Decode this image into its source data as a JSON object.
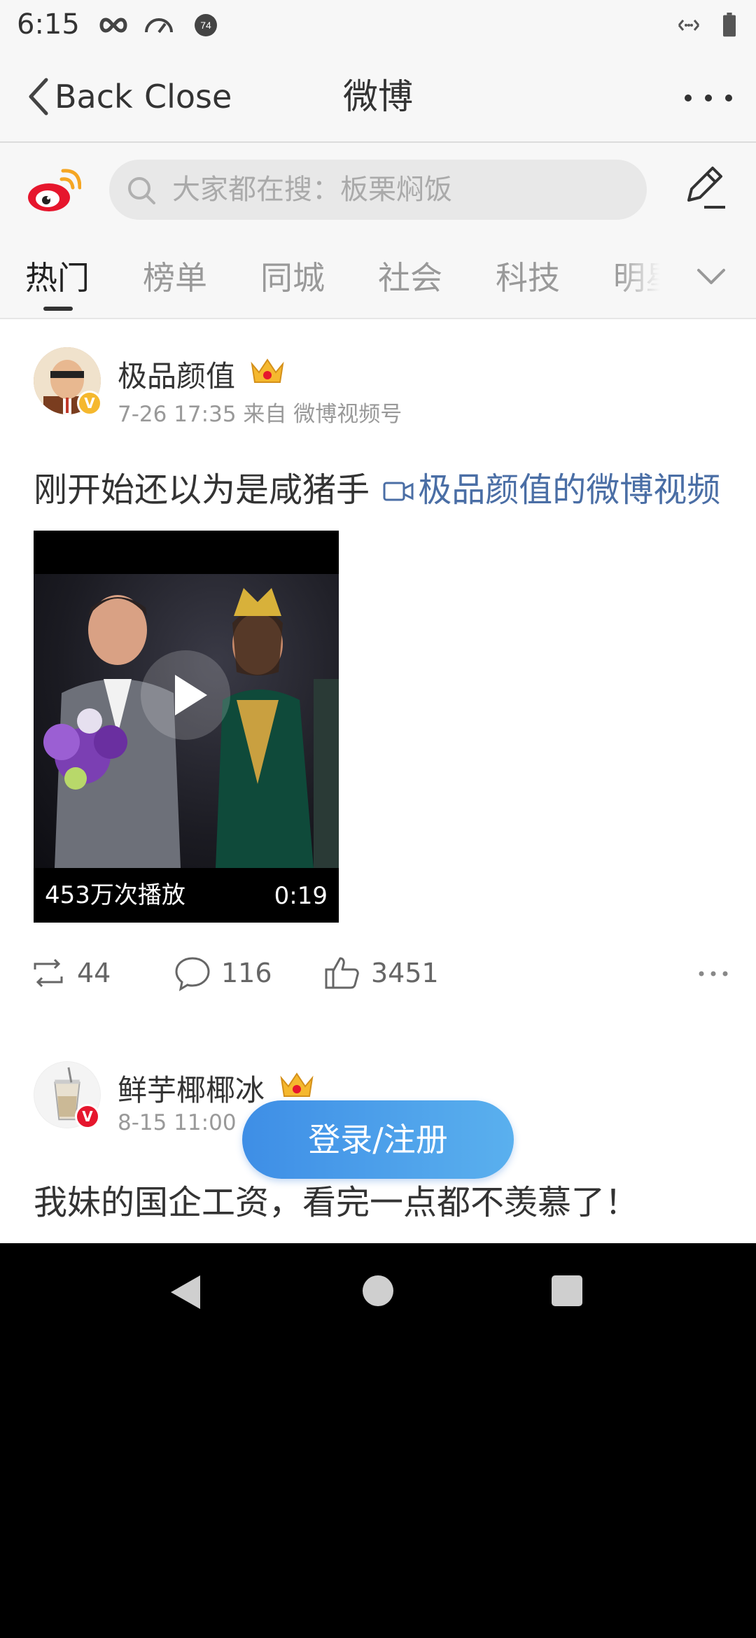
{
  "status_bar": {
    "time": "6:15",
    "icons": [
      "infinity-icon",
      "speedometer-icon",
      "notification-74-icon",
      "data-arrows-icon",
      "battery-icon"
    ],
    "notification_badge": "74"
  },
  "nav": {
    "back_label": "Back",
    "close_label": "Close",
    "title": "微博"
  },
  "search": {
    "placeholder": "大家都在搜：板栗焖饭"
  },
  "tabs": [
    {
      "label": "热门",
      "active": true
    },
    {
      "label": "榜单",
      "active": false
    },
    {
      "label": "同城",
      "active": false
    },
    {
      "label": "社会",
      "active": false
    },
    {
      "label": "科技",
      "active": false
    },
    {
      "label": "明星",
      "active": false
    }
  ],
  "posts": [
    {
      "username": "极品颜值",
      "meta": "7-26 17:35 来自 微博视频号",
      "text": "刚开始还以为是咸猪手",
      "video_link": "极品颜值的微博视频",
      "video": {
        "views": "453万次播放",
        "duration": "0:19"
      },
      "reposts": "44",
      "comments": "116",
      "likes": "3451"
    },
    {
      "username": "鲜芋椰椰冰",
      "meta": "8-15 11:00",
      "text": "我妹的国企工资，看完一点都不羡慕了！"
    }
  ],
  "login_button": "登录/注册",
  "colors": {
    "accent_blue": "#4a90e2",
    "link_blue": "#4a6ea5",
    "weibo_red": "#e6162d",
    "verified_gold": "#f5b82e"
  }
}
